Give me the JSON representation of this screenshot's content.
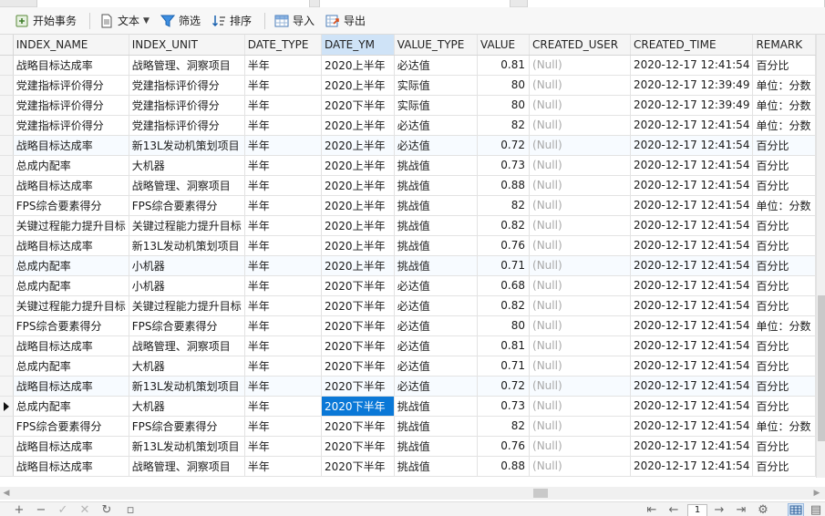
{
  "toolbar": {
    "begin_transaction": "开始事务",
    "text": "文本",
    "filter": "筛选",
    "sort": "排序",
    "import": "导入",
    "export": "导出"
  },
  "columns": [
    "INDEX_NAME",
    "INDEX_UNIT",
    "DATE_TYPE",
    "DATE_YM",
    "VALUE_TYPE",
    "VALUE",
    "CREATED_USER",
    "CREATED_TIME",
    "REMARK"
  ],
  "rows": [
    [
      "战略目标达成率",
      "战略管理、洞察项目",
      "半年",
      "2020上半年",
      "必达值",
      "0.81",
      "(Null)",
      "2020-12-17 12:41:54",
      "百分比"
    ],
    [
      "党建指标评价得分",
      "党建指标评价得分",
      "半年",
      "2020上半年",
      "实际值",
      "80",
      "(Null)",
      "2020-12-17 12:39:49",
      "单位：分数"
    ],
    [
      "党建指标评价得分",
      "党建指标评价得分",
      "半年",
      "2020下半年",
      "实际值",
      "80",
      "(Null)",
      "2020-12-17 12:39:49",
      "单位：分数"
    ],
    [
      "党建指标评价得分",
      "党建指标评价得分",
      "半年",
      "2020上半年",
      "必达值",
      "82",
      "(Null)",
      "2020-12-17 12:41:54",
      "单位：分数"
    ],
    [
      "战略目标达成率",
      "新13L发动机策划项目",
      "半年",
      "2020上半年",
      "必达值",
      "0.72",
      "(Null)",
      "2020-12-17 12:41:54",
      "百分比"
    ],
    [
      "总成内配率",
      "大机器",
      "半年",
      "2020上半年",
      "挑战值",
      "0.73",
      "(Null)",
      "2020-12-17 12:41:54",
      "百分比"
    ],
    [
      "战略目标达成率",
      "战略管理、洞察项目",
      "半年",
      "2020上半年",
      "挑战值",
      "0.88",
      "(Null)",
      "2020-12-17 12:41:54",
      "百分比"
    ],
    [
      "FPS综合要素得分",
      "FPS综合要素得分",
      "半年",
      "2020上半年",
      "挑战值",
      "82",
      "(Null)",
      "2020-12-17 12:41:54",
      "单位：分数"
    ],
    [
      "关键过程能力提升目标",
      "关键过程能力提升目标",
      "半年",
      "2020上半年",
      "挑战值",
      "0.82",
      "(Null)",
      "2020-12-17 12:41:54",
      "百分比"
    ],
    [
      "战略目标达成率",
      "新13L发动机策划项目",
      "半年",
      "2020上半年",
      "挑战值",
      "0.76",
      "(Null)",
      "2020-12-17 12:41:54",
      "百分比"
    ],
    [
      "总成内配率",
      "小机器",
      "半年",
      "2020上半年",
      "挑战值",
      "0.71",
      "(Null)",
      "2020-12-17 12:41:54",
      "百分比"
    ],
    [
      "总成内配率",
      "小机器",
      "半年",
      "2020下半年",
      "必达值",
      "0.68",
      "(Null)",
      "2020-12-17 12:41:54",
      "百分比"
    ],
    [
      "关键过程能力提升目标",
      "关键过程能力提升目标",
      "半年",
      "2020下半年",
      "必达值",
      "0.82",
      "(Null)",
      "2020-12-17 12:41:54",
      "百分比"
    ],
    [
      "FPS综合要素得分",
      "FPS综合要素得分",
      "半年",
      "2020下半年",
      "必达值",
      "80",
      "(Null)",
      "2020-12-17 12:41:54",
      "单位：分数"
    ],
    [
      "战略目标达成率",
      "战略管理、洞察项目",
      "半年",
      "2020下半年",
      "必达值",
      "0.81",
      "(Null)",
      "2020-12-17 12:41:54",
      "百分比"
    ],
    [
      "总成内配率",
      "大机器",
      "半年",
      "2020下半年",
      "必达值",
      "0.71",
      "(Null)",
      "2020-12-17 12:41:54",
      "百分比"
    ],
    [
      "战略目标达成率",
      "新13L发动机策划项目",
      "半年",
      "2020下半年",
      "必达值",
      "0.72",
      "(Null)",
      "2020-12-17 12:41:54",
      "百分比"
    ],
    [
      "总成内配率",
      "大机器",
      "半年",
      "2020下半年",
      "挑战值",
      "0.73",
      "(Null)",
      "2020-12-17 12:41:54",
      "百分比"
    ],
    [
      "FPS综合要素得分",
      "FPS综合要素得分",
      "半年",
      "2020下半年",
      "挑战值",
      "82",
      "(Null)",
      "2020-12-17 12:41:54",
      "单位：分数"
    ],
    [
      "战略目标达成率",
      "新13L发动机策划项目",
      "半年",
      "2020下半年",
      "挑战值",
      "0.76",
      "(Null)",
      "2020-12-17 12:41:54",
      "百分比"
    ],
    [
      "战略目标达成率",
      "战略管理、洞察项目",
      "半年",
      "2020下半年",
      "挑战值",
      "0.88",
      "(Null)",
      "2020-12-17 12:41:54",
      "百分比"
    ]
  ],
  "selection": {
    "row": 17,
    "col": 3
  },
  "pager": {
    "page": "1"
  },
  "colors": {
    "selected_cell": "#0a78d7",
    "selected_header": "#cfe3f7",
    "null_text": "#a8a8a8"
  }
}
